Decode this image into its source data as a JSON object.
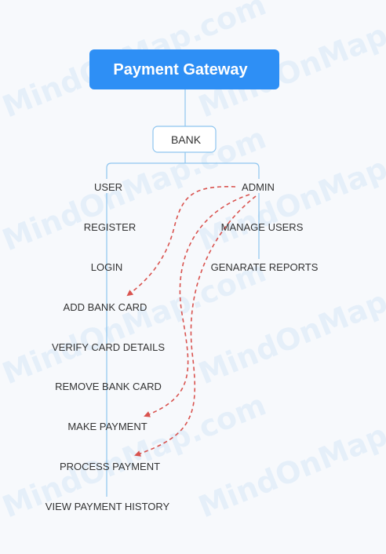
{
  "diagram": {
    "root": "Payment Gateway",
    "hub": "BANK",
    "user": {
      "label": "USER",
      "children": [
        "REGISTER",
        "LOGIN",
        "ADD BANK CARD",
        "VERIFY CARD DETAILS",
        "REMOVE BANK CARD",
        "MAKE PAYMENT",
        "PROCESS PAYMENT",
        "VIEW PAYMENT HISTORY"
      ]
    },
    "admin": {
      "label": "ADMIN",
      "children": [
        "MANAGE USERS",
        "GENARATE REPORTS"
      ]
    }
  },
  "watermark": "MindOnMap.com",
  "colors": {
    "root_fill": "#2e8ff5",
    "edge": "#8ec5ef",
    "dashed_link": "#d9534f",
    "text": "#333333",
    "background": "#f7f9fc"
  }
}
